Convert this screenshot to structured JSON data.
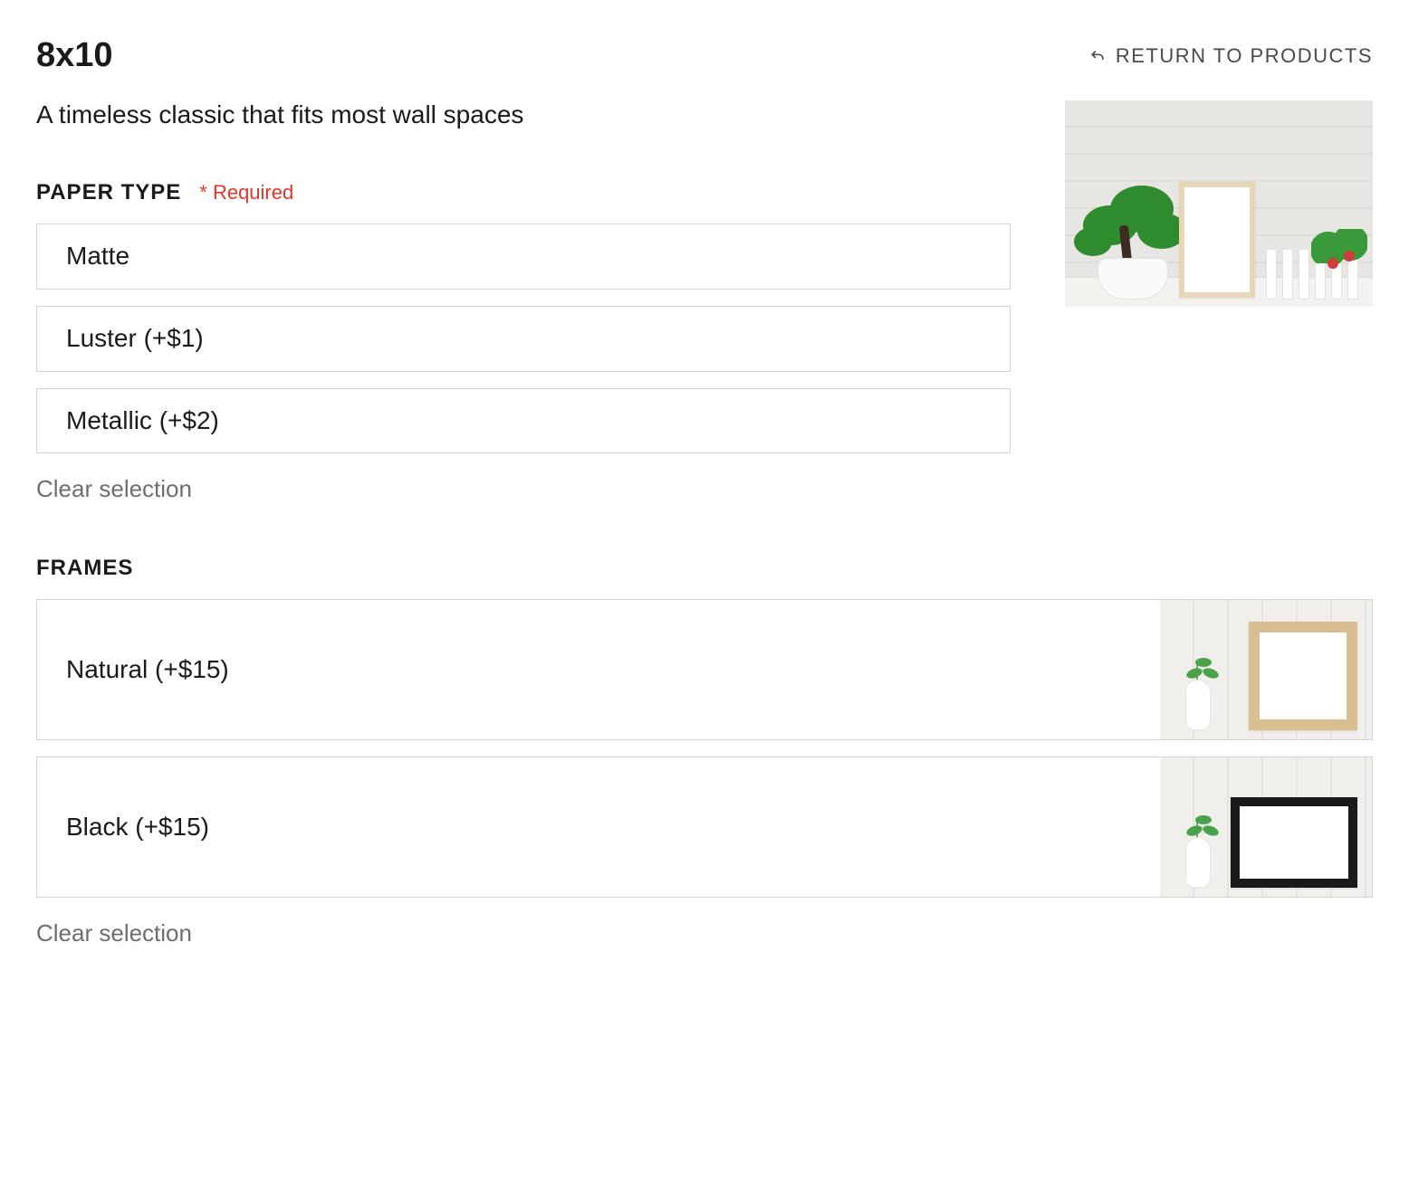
{
  "header": {
    "title": "8x10",
    "return_label": "RETURN TO PRODUCTS"
  },
  "subtitle": "A timeless classic that fits most wall spaces",
  "sections": {
    "paper": {
      "label": "PAPER TYPE",
      "required_label": "* Required",
      "options": [
        {
          "label": "Matte"
        },
        {
          "label": "Luster (+$1)"
        },
        {
          "label": "Metallic (+$2)"
        }
      ],
      "clear_label": "Clear selection"
    },
    "frames": {
      "label": "FRAMES",
      "options": [
        {
          "label": "Natural (+$15)",
          "variant": "natural"
        },
        {
          "label": "Black (+$15)",
          "variant": "black"
        }
      ],
      "clear_label": "Clear selection"
    }
  }
}
